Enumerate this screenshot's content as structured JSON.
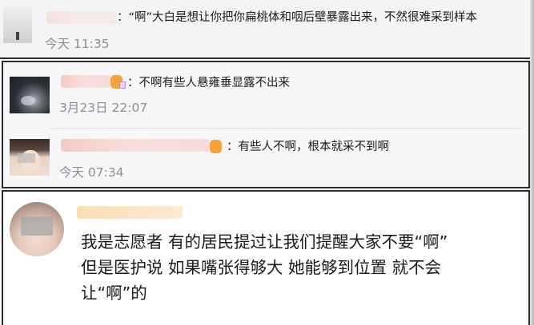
{
  "comments": [
    {
      "text": "：“啊”大白是想让你把你扁桃体和咽后壁暴露出来，不然很难采到样本",
      "time": "今天 11:35"
    },
    {
      "text": "：不啊有些人悬雍垂显露不出来",
      "time": "3月23日 22:07"
    },
    {
      "text": "：有些人不啊，根本就采不到啊",
      "time": "今天 07:34"
    }
  ],
  "post": {
    "lines": [
      "我是志愿者 有的居民提过让我们提醒大家不要“啊”",
      "但是医护说 如果嘴张得够大 她能够到位置 就不会",
      "让“啊”的"
    ]
  }
}
